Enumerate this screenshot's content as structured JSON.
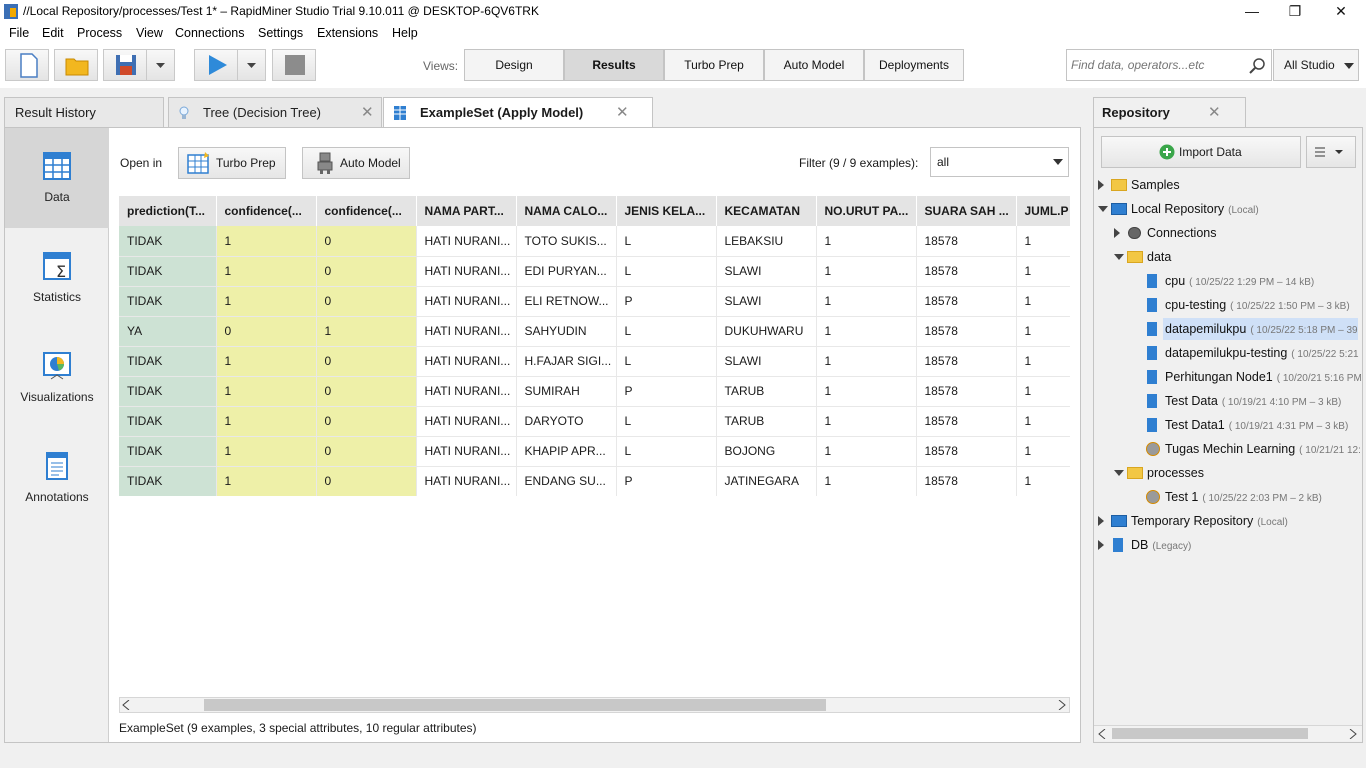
{
  "window": {
    "title": "//Local Repository/processes/Test 1* – RapidMiner Studio Trial 9.10.011 @ DESKTOP-6QV6TRK",
    "minimize": "—",
    "maximize": "❐",
    "close": "✕"
  },
  "menu": [
    "File",
    "Edit",
    "Process",
    "View",
    "Connections",
    "Settings",
    "Extensions",
    "Help"
  ],
  "toolbar": {
    "views_label": "Views:",
    "views": [
      "Design",
      "Results",
      "Turbo Prep",
      "Auto Model",
      "Deployments"
    ],
    "active_view": "Results",
    "search_placeholder": "Find data, operators...etc",
    "studio_label": "All Studio"
  },
  "tabs": [
    {
      "label": "Result History"
    },
    {
      "label": "Tree (Decision Tree)"
    },
    {
      "label": "ExampleSet (Apply Model)"
    }
  ],
  "side": [
    {
      "label": "Data",
      "icon": "data-grid-icon"
    },
    {
      "label": "Statistics",
      "icon": "statistics-icon"
    },
    {
      "label": "Visualizations",
      "icon": "visualizations-icon"
    },
    {
      "label": "Annotations",
      "icon": "annotations-icon"
    }
  ],
  "open_in": {
    "label": "Open in",
    "turbo_prep": "Turbo Prep",
    "auto_model": "Auto Model"
  },
  "filter": {
    "label": "Filter (9 / 9 examples):",
    "value": "all"
  },
  "table": {
    "columns": [
      "prediction(T...",
      "confidence(...",
      "confidence(...",
      "NAMA PART...",
      "NAMA CALO...",
      "JENIS KELA...",
      "KECAMATAN",
      "NO.URUT PA...",
      "SUARA SAH ...",
      "JUML.P"
    ],
    "rows": [
      [
        "TIDAK",
        "1",
        "0",
        "HATI NURANI...",
        "TOTO SUKIS...",
        "L",
        "LEBAKSIU",
        "1",
        "18578",
        "1"
      ],
      [
        "TIDAK",
        "1",
        "0",
        "HATI NURANI...",
        "EDI PURYAN...",
        "L",
        "SLAWI",
        "1",
        "18578",
        "1"
      ],
      [
        "TIDAK",
        "1",
        "0",
        "HATI NURANI...",
        "ELI RETNOW...",
        "P",
        "SLAWI",
        "1",
        "18578",
        "1"
      ],
      [
        "YA",
        "0",
        "1",
        "HATI NURANI...",
        "SAHYUDIN",
        "L",
        "DUKUHWARU",
        "1",
        "18578",
        "1"
      ],
      [
        "TIDAK",
        "1",
        "0",
        "HATI NURANI...",
        "H.FAJAR SIGI...",
        "L",
        "SLAWI",
        "1",
        "18578",
        "1"
      ],
      [
        "TIDAK",
        "1",
        "0",
        "HATI NURANI...",
        "SUMIRAH",
        "P",
        "TARUB",
        "1",
        "18578",
        "1"
      ],
      [
        "TIDAK",
        "1",
        "0",
        "HATI NURANI...",
        "DARYOTO",
        "L",
        "TARUB",
        "1",
        "18578",
        "1"
      ],
      [
        "TIDAK",
        "1",
        "0",
        "HATI NURANI...",
        "KHAPIP APR...",
        "L",
        "BOJONG",
        "1",
        "18578",
        "1"
      ],
      [
        "TIDAK",
        "1",
        "0",
        "HATI NURANI...",
        "ENDANG SU...",
        "P",
        "JATINEGARA",
        "1",
        "18578",
        "1"
      ]
    ]
  },
  "status": "ExampleSet (9 examples, 3 special attributes, 10 regular attributes)",
  "repository": {
    "title": "Repository",
    "import_label": "Import Data",
    "items": [
      {
        "label": "Samples",
        "meta": ""
      },
      {
        "label": "Local Repository",
        "meta": "(Local)"
      },
      {
        "label": "Connections",
        "meta": ""
      },
      {
        "label": "data",
        "meta": ""
      },
      {
        "label": "cpu",
        "meta": "( 10/25/22 1:29 PM – 14 kB)"
      },
      {
        "label": "cpu-testing",
        "meta": "( 10/25/22 1:50 PM – 3 kB)"
      },
      {
        "label": "datapemilukpu",
        "meta": "( 10/25/22 5:18 PM – 39"
      },
      {
        "label": "datapemilukpu-testing",
        "meta": "( 10/25/22 5:21"
      },
      {
        "label": "Perhitungan Node1",
        "meta": "( 10/20/21 5:16 PM"
      },
      {
        "label": "Test Data",
        "meta": "( 10/19/21 4:10 PM – 3 kB)"
      },
      {
        "label": "Test Data1",
        "meta": "( 10/19/21 4:31 PM – 3 kB)"
      },
      {
        "label": "Tugas Mechin Learning",
        "meta": "( 10/21/21 12:"
      },
      {
        "label": "processes",
        "meta": ""
      },
      {
        "label": "Test 1",
        "meta": "( 10/25/22 2:03 PM – 2 kB)"
      },
      {
        "label": "Temporary Repository",
        "meta": "(Local)"
      },
      {
        "label": "DB",
        "meta": "(Legacy)"
      }
    ]
  },
  "colors": {
    "prediction": "#cde2d4",
    "confidence": "#eef0a8",
    "selected": "#cfe0f7"
  }
}
